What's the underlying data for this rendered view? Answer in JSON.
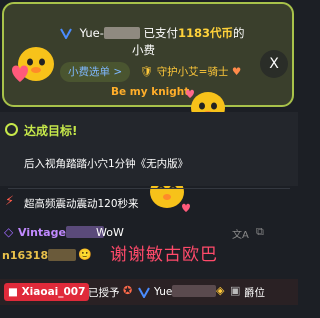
{
  "tip": {
    "user": "Yue-",
    "action": "已支付",
    "amount": "1183代币",
    "suffix": "的",
    "line2": "小费",
    "menu_chip": "小费选单 >",
    "guard_text": "守护小艾=骑士",
    "knight_text": "Be my knight",
    "close_label": "X"
  },
  "achievement": {
    "title": "达成目标!",
    "description": "后入视角踏踏小穴1分钟《无内版》"
  },
  "vibration": {
    "text": "超高频震动震动120秒来"
  },
  "chat": [
    {
      "name": "Vintage",
      "message": "WoW"
    },
    {
      "name": "n16318",
      "message": ""
    }
  ],
  "overlay_text": "谢谢敏古欧巴",
  "bottom": {
    "live_name": "Xiaoai_007",
    "action": "已授予",
    "target": "Yue",
    "rank": "爵位"
  },
  "colors": {
    "accent_green": "#a8c24a",
    "gold": "#ffd23a",
    "live_red": "#e02a3a"
  }
}
